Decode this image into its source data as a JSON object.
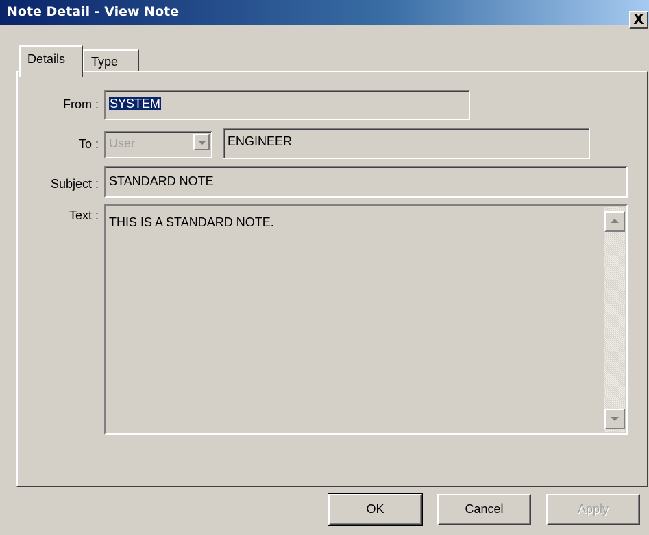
{
  "window": {
    "title": "Note Detail - View Note",
    "close_glyph": "X"
  },
  "tabs": [
    {
      "label": "Details",
      "active": true
    },
    {
      "label": "Type",
      "active": false
    }
  ],
  "form": {
    "from_label": "From :",
    "from_value": "SYSTEM",
    "to_label": "To :",
    "to_type_value": "User",
    "to_value": "ENGINEER",
    "subject_label": "Subject :",
    "subject_value": "STANDARD NOTE",
    "text_label": "Text :",
    "text_value": "THIS IS A STANDARD NOTE."
  },
  "buttons": {
    "ok": "OK",
    "cancel": "Cancel",
    "apply": "Apply"
  },
  "colors": {
    "title_gradient_start": "#0a246a",
    "title_gradient_end": "#a6caf0",
    "face": "#d4d0c8",
    "selection": "#0a246a"
  }
}
